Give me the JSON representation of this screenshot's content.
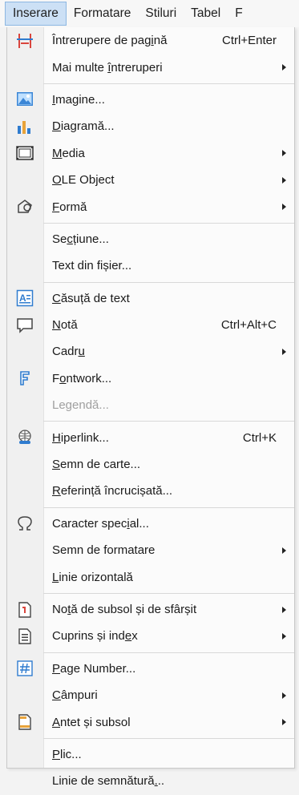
{
  "menubar": {
    "items": [
      "Inserare",
      "Formatare",
      "Stiluri",
      "Tabel",
      "F"
    ]
  },
  "menu": {
    "groups": [
      [
        {
          "label": "Întrerupere de pagină",
          "shortcut": "Ctrl+Enter",
          "icon": "page-break-icon",
          "submenu": false
        },
        {
          "label": "Mai multe întreruperi",
          "shortcut": "",
          "icon": "",
          "submenu": true
        }
      ],
      [
        {
          "label": "Imagine...",
          "shortcut": "",
          "icon": "image-icon",
          "submenu": false
        },
        {
          "label": "Diagramă...",
          "shortcut": "",
          "icon": "chart-icon",
          "submenu": false
        },
        {
          "label": "Media",
          "shortcut": "",
          "icon": "media-icon",
          "submenu": true
        },
        {
          "label": "OLE Object",
          "shortcut": "",
          "icon": "",
          "submenu": true
        },
        {
          "label": "Formă",
          "shortcut": "",
          "icon": "shape-icon",
          "submenu": true
        }
      ],
      [
        {
          "label": "Secțiune...",
          "shortcut": "",
          "icon": "",
          "submenu": false
        },
        {
          "label": "Text din fișier...",
          "shortcut": "",
          "icon": "",
          "submenu": false
        }
      ],
      [
        {
          "label": "Căsuță de text",
          "shortcut": "",
          "icon": "textbox-icon",
          "submenu": false
        },
        {
          "label": "Notă",
          "shortcut": "Ctrl+Alt+C",
          "icon": "comment-icon",
          "submenu": false
        },
        {
          "label": "Cadru",
          "shortcut": "",
          "icon": "",
          "submenu": true
        },
        {
          "label": "Fontwork...",
          "shortcut": "",
          "icon": "fontwork-icon",
          "submenu": false
        },
        {
          "label": "Legendă...",
          "shortcut": "",
          "icon": "",
          "submenu": false,
          "disabled": true
        }
      ],
      [
        {
          "label": "Hiperlink...",
          "shortcut": "Ctrl+K",
          "icon": "hyperlink-icon",
          "submenu": false
        },
        {
          "label": "Semn de carte...",
          "shortcut": "",
          "icon": "",
          "submenu": false
        },
        {
          "label": "Referință încrucișată...",
          "shortcut": "",
          "icon": "",
          "submenu": false
        }
      ],
      [
        {
          "label": "Caracter special...",
          "shortcut": "",
          "icon": "omega-icon",
          "submenu": false
        },
        {
          "label": "Semn de formatare",
          "shortcut": "",
          "icon": "",
          "submenu": true
        },
        {
          "label": "Linie orizontală",
          "shortcut": "",
          "icon": "",
          "submenu": false
        }
      ],
      [
        {
          "label": "Notă de subsol și de sfârșit",
          "shortcut": "",
          "icon": "footnote-icon",
          "submenu": true
        },
        {
          "label": "Cuprins și index",
          "shortcut": "",
          "icon": "toc-icon",
          "submenu": true
        }
      ],
      [
        {
          "label": "Page Number...",
          "shortcut": "",
          "icon": "page-number-icon",
          "submenu": false
        },
        {
          "label": "Câmpuri",
          "shortcut": "",
          "icon": "",
          "submenu": true
        },
        {
          "label": "Antet și subsol",
          "shortcut": "",
          "icon": "header-footer-icon",
          "submenu": true
        }
      ],
      [
        {
          "label": "Plic...",
          "shortcut": "",
          "icon": "",
          "submenu": false
        },
        {
          "label": "Linie de semnătură...",
          "shortcut": "",
          "icon": "",
          "submenu": false
        }
      ]
    ]
  },
  "colors": {
    "highlight": "#cce0f5",
    "gutter": "#f0f0f0",
    "accent_blue": "#2f7ccf",
    "accent_red": "#d9453d",
    "accent_orange": "#e8a33a"
  }
}
